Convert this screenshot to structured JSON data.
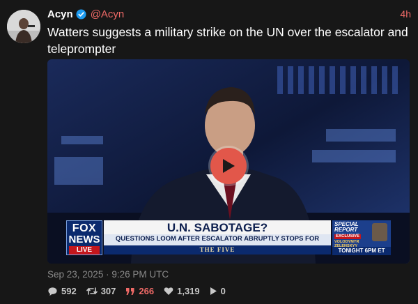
{
  "author": {
    "name": "Acyn",
    "handle": "@Acyn",
    "time": "4h",
    "verified": true
  },
  "post_text": "Watters suggests a military strike on the UN over the escalator and teleprompter",
  "video": {
    "banner_headline": "U.N. SABOTAGE?",
    "banner_sub": "QUESTIONS LOOM AFTER ESCALATOR ABRUPTLY STOPS FOR TRUMP",
    "show_name": "THE FIVE",
    "logo_line1": "FOX",
    "logo_line2": "NEWS",
    "logo_line3": "LIVE",
    "promo_special": "SPECIAL REPORT",
    "promo_exclusive": "EXCLUSIVE",
    "promo_guest": "VOLODYMYR ZELENSKYY",
    "promo_time": "TONIGHT 6PM ET",
    "play_icon": "play-icon"
  },
  "timestamp": "Sep 23, 2025 · 9:26 PM UTC",
  "stats": {
    "replies": "592",
    "reposts": "307",
    "quotes": "266",
    "likes": "1,319",
    "views": "0"
  },
  "colors": {
    "accent": "#f06a67",
    "background": "#171717",
    "play_button": "#e2574a"
  }
}
